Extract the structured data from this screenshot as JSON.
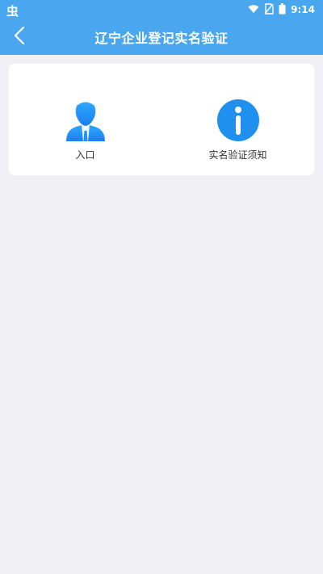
{
  "status": {
    "left_icon": "虫",
    "time": "9:14",
    "icons": [
      "wifi-icon",
      "sim-off-icon",
      "battery-icon"
    ]
  },
  "header": {
    "title": "辽宁企业登记实名验证",
    "back_icon": "chevron-left-icon"
  },
  "main": {
    "tiles": [
      {
        "label": "入口",
        "icon": "user-silhouette-icon"
      },
      {
        "label": "实名验证须知",
        "icon": "info-circle-icon"
      }
    ]
  },
  "colors": {
    "header_bg": "#4aa7ef",
    "page_bg": "#efeff4",
    "icon_blue": "#1f8ff0"
  }
}
